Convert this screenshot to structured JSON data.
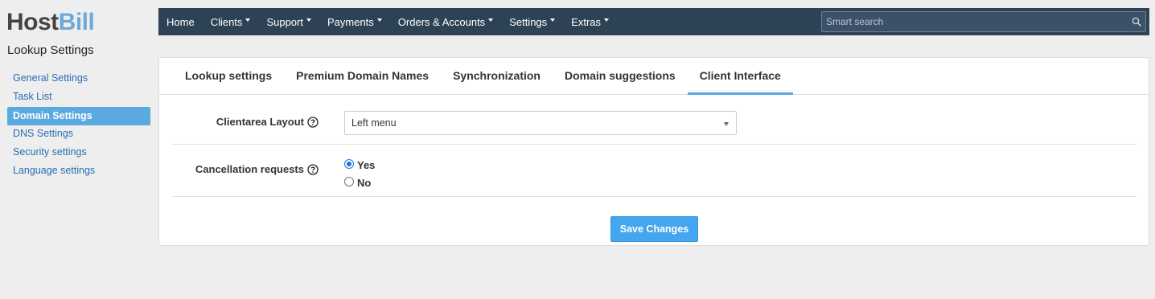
{
  "brand": {
    "part1": "Host",
    "part2": "Bill",
    "color_accent": "#6ea9dc"
  },
  "sidebar": {
    "section_title": "Lookup Settings",
    "items": [
      {
        "label": "General Settings",
        "active": false
      },
      {
        "label": "Task List",
        "active": false
      },
      {
        "label": "Domain Settings",
        "active": true
      },
      {
        "label": "DNS Settings",
        "active": false
      },
      {
        "label": "Security settings",
        "active": false
      },
      {
        "label": "Language settings",
        "active": false
      }
    ]
  },
  "topnav": {
    "items": [
      {
        "label": "Home",
        "has_dropdown": false
      },
      {
        "label": "Clients",
        "has_dropdown": true
      },
      {
        "label": "Support",
        "has_dropdown": true
      },
      {
        "label": "Payments",
        "has_dropdown": true
      },
      {
        "label": "Orders & Accounts",
        "has_dropdown": true
      },
      {
        "label": "Settings",
        "has_dropdown": true
      },
      {
        "label": "Extras",
        "has_dropdown": true
      }
    ],
    "search": {
      "placeholder": "Smart search",
      "value": "",
      "icon": "search-icon"
    },
    "background": "#2e4256"
  },
  "tabs": [
    {
      "label": "Lookup settings",
      "active": false
    },
    {
      "label": "Premium Domain Names",
      "active": false
    },
    {
      "label": "Synchronization",
      "active": false
    },
    {
      "label": "Domain suggestions",
      "active": false
    },
    {
      "label": "Client Interface",
      "active": true
    }
  ],
  "form": {
    "clientarea_layout": {
      "label": "Clientarea Layout",
      "value": "Left menu",
      "help_icon": "question-circle-icon"
    },
    "cancellation_requests": {
      "label": "Cancellation requests",
      "help_icon": "question-circle-icon",
      "options": [
        {
          "label": "Yes",
          "checked": true
        },
        {
          "label": "No",
          "checked": false
        }
      ]
    },
    "save_label": "Save Changes"
  },
  "colors": {
    "active_blue": "#5aa9e0",
    "button_blue": "#43a6ee",
    "link_blue": "#2a6db5"
  }
}
